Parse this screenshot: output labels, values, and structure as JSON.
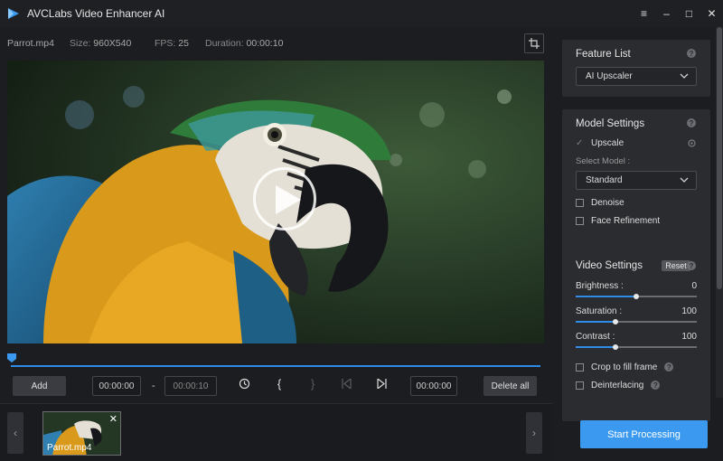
{
  "app": {
    "title": "AVCLabs Video Enhancer AI"
  },
  "window": {
    "menu": "≡",
    "minimize": "–",
    "maximize": "□",
    "close": "✕"
  },
  "info": {
    "filename": "Parrot.mp4",
    "size_label": "Size:",
    "size_value": "960X540",
    "fps_label": "FPS:",
    "fps_value": "25",
    "duration_label": "Duration:",
    "duration_value": "00:00:10"
  },
  "controls": {
    "add_label": "Add",
    "start_time": "00:00:00",
    "separator": "-",
    "end_time": "00:00:10",
    "delete_all_label": "Delete all",
    "bracket_open": "{",
    "bracket_close": "}"
  },
  "strip": {
    "thumbs": [
      {
        "label": "Parrot.mp4",
        "close": "✕"
      }
    ],
    "prev": "‹",
    "next": "›"
  },
  "feature_list": {
    "title": "Feature List",
    "selected": "AI Upscaler"
  },
  "model_settings": {
    "title": "Model Settings",
    "upscale_label": "Upscale",
    "upscale_checked": true,
    "select_model_label": "Select Model :",
    "selected_model": "Standard",
    "denoise_label": "Denoise",
    "face_refinement_label": "Face Refinement"
  },
  "video_settings": {
    "title": "Video Settings",
    "reset_label": "Reset",
    "sliders": [
      {
        "label": "Brightness :",
        "value": "0",
        "fraction": 0.5
      },
      {
        "label": "Saturation :",
        "value": "100",
        "fraction": 0.33
      },
      {
        "label": "Contrast :",
        "value": "100",
        "fraction": 0.33
      }
    ],
    "crop_label": "Crop to fill frame",
    "deinterlacing_label": "Deinterlacing"
  },
  "start_processing_label": "Start Processing",
  "colors": {
    "accent": "#3b9af0",
    "panel": "#2b2c30",
    "background": "#1c1d20"
  },
  "help_glyph": "?"
}
